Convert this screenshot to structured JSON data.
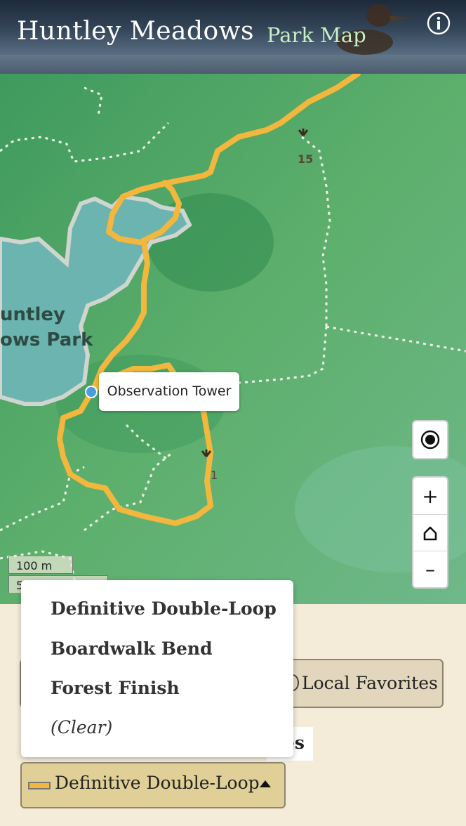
{
  "header": {
    "title": "Huntley Meadows",
    "subtitle": "Park Map",
    "info_icon": "info-icon"
  },
  "map": {
    "place_label_line1": "untley",
    "place_label_line2": "ows Park",
    "callout_label": "Observation Tower",
    "poi_15_label": "15",
    "poi_1_label": "1",
    "scale_100": "100 m",
    "scale_500": "5",
    "route_color": "#f2b73c",
    "water_color": "#6cb4b0"
  },
  "controls": {
    "locate_icon": "locate-icon",
    "zoom_in_label": "+",
    "home_icon": "home-icon",
    "zoom_out_label": "–"
  },
  "panel": {
    "favorites_label": "Local Favorites",
    "hidden_text": "es"
  },
  "dropdown": {
    "items": [
      "Definitive Double-Loop",
      "Boardwalk Bend",
      "Forest Finish",
      "(Clear)"
    ]
  },
  "route_select": {
    "selected": "Definitive Double-Loop"
  }
}
